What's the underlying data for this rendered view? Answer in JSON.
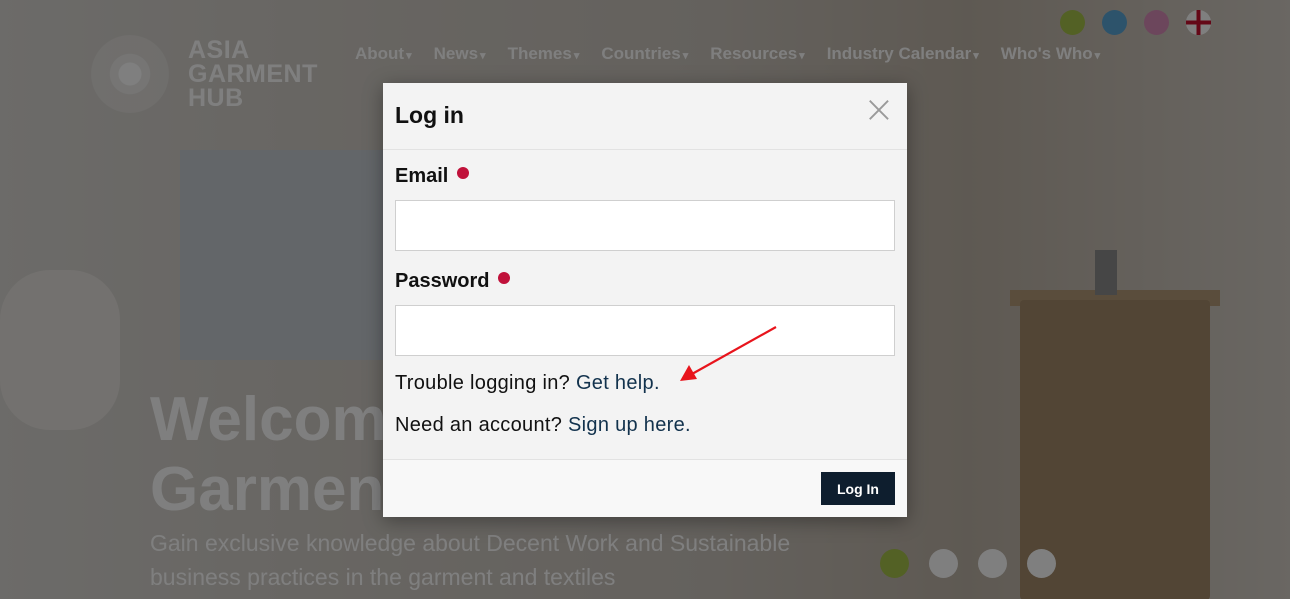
{
  "background": {
    "logo": {
      "lines": [
        "ASIA",
        "GARMENT",
        "HUB"
      ]
    },
    "top_icons": [
      {
        "icon": "green-circle-icon",
        "color": "#a6c24a"
      },
      {
        "icon": "blue-circle-icon",
        "color": "#5aa6d6"
      },
      {
        "icon": "pink-circle-icon",
        "color": "#d98cb8"
      },
      {
        "icon": "uk-flag-icon",
        "color": "#c8102e"
      }
    ],
    "nav": [
      {
        "label": "About"
      },
      {
        "label": "News"
      },
      {
        "label": "Themes"
      },
      {
        "label": "Countries"
      },
      {
        "label": "Resources"
      },
      {
        "label": "Industry Calendar"
      },
      {
        "label": "Who's Who"
      }
    ],
    "nav_caret": "▾",
    "hero": {
      "title_line1": "Welcome to Asia",
      "title_line2": "Garment Hub",
      "subtitle": "Gain exclusive knowledge about Decent Work and Sustainable business practices in the garment and textiles"
    },
    "carousel_dots": 4,
    "colors": {
      "accent_green": "#a6c24a",
      "overlay": "rgba(0,0,0,0.5)"
    }
  },
  "modal": {
    "title": "Log in",
    "close_glyph": "×",
    "email": {
      "label": "Email",
      "value": "",
      "placeholder": ""
    },
    "password": {
      "label": "Password",
      "value": "",
      "placeholder": ""
    },
    "help": {
      "prefix": "Trouble logging in?",
      "link": "Get help."
    },
    "signup": {
      "prefix": "Need an account?",
      "link": "Sign up here."
    },
    "submit_label": "Log In",
    "colors": {
      "required": "#c0113a",
      "button": "#0e1e2e",
      "link": "#12324d",
      "annotation_arrow": "#e8141c"
    }
  }
}
